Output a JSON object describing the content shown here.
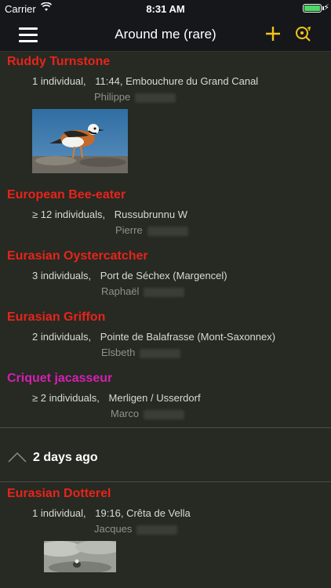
{
  "status_bar": {
    "carrier": "Carrier",
    "time": "8:31 AM"
  },
  "nav": {
    "title": "Around me (rare)",
    "menu_icon": "hamburger-icon",
    "add_icon": "plus-icon",
    "location_icon": "location-refresh-icon"
  },
  "colors": {
    "rare": "#e8231c",
    "insect": "#d61eb4",
    "accent": "#f5c518"
  },
  "observations": [
    {
      "species": "Ruddy Turnstone",
      "count": "1 individual,",
      "time": "11:44,",
      "place": "Embouchure du Grand Canal",
      "observer": "Philippe",
      "has_photo": true
    },
    {
      "species": "European Bee-eater",
      "count": "≥ 12 individuals,",
      "time": "",
      "place": "Russubrunnu W",
      "observer": "Pierre"
    },
    {
      "species": "Eurasian Oystercatcher",
      "count": "3 individuals,",
      "time": "",
      "place": "Port de Séchex (Margencel)",
      "observer": "Raphaël"
    },
    {
      "species": "Eurasian Griffon",
      "count": "2 individuals,",
      "time": "",
      "place": "Pointe de Balafrasse (Mont-Saxonnex)",
      "observer": "Elsbeth"
    },
    {
      "species": "Criquet jacasseur",
      "count": "≥ 2 individuals,",
      "time": "",
      "place": "Merligen / Usserdorf",
      "observer": "Marco"
    }
  ],
  "day_header": {
    "label": "2 days ago"
  },
  "observations_2": [
    {
      "species": "Eurasian Dotterel",
      "count": "1 individual,",
      "time": "19:16,",
      "place": "Crêta de Vella",
      "observer": "Jacques",
      "has_photo": true
    }
  ]
}
